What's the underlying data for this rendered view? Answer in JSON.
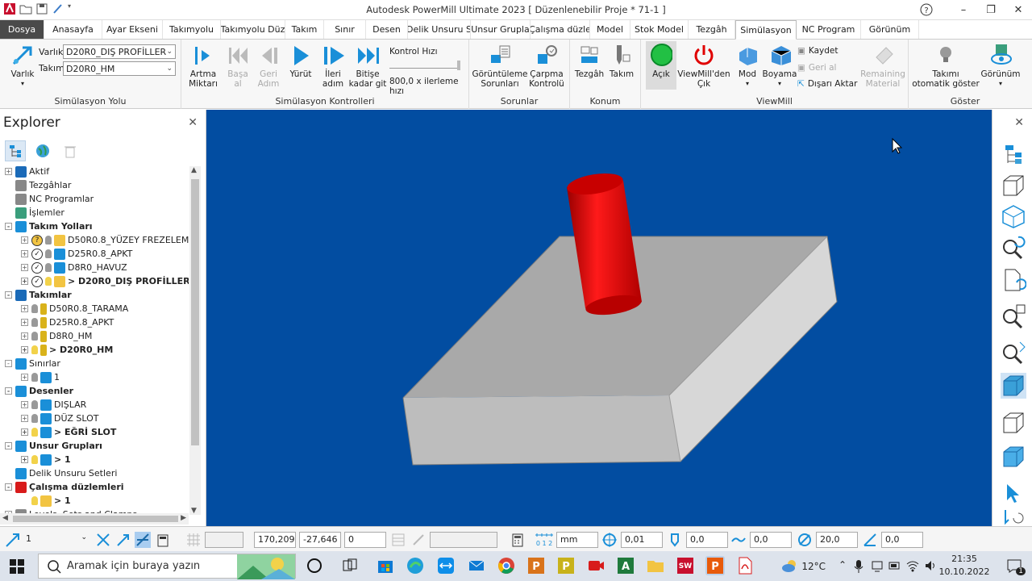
{
  "window": {
    "title": "Autodesk PowerMill Ultimate 2023   [ Düzenlenebilir Proje * 71-1 ]"
  },
  "tabs": [
    "Dosya",
    "Anasayfa",
    "Ayar Ekseni",
    "Takımyolu",
    "Takımyolu Düz",
    "Takım",
    "Sınır",
    "Desen",
    "Delik Unsuru S",
    "Unsur Grupla",
    "Çalışma düzle",
    "Model",
    "Stok Model",
    "Tezgâh",
    "Simülasyon",
    "NC Program",
    "Görünüm"
  ],
  "active_tab": "Simülasyon",
  "ribbon": {
    "sim_path": {
      "varlik_big": "Varlık",
      "varlik_label": "Varlık",
      "varlik_value": "D20R0_DIŞ PROFİLLER",
      "takim_label": "Takım",
      "takim_value": "D20R0_HM",
      "group_label": "Simülasyon Yolu"
    },
    "sim_controls": {
      "artma": "Artma\nMiktarı",
      "basa": "Başa\nal",
      "geri": "Geri\nAdım",
      "yurut": "Yürüt",
      "ileri": "İleri\nadım",
      "bitise": "Bitişe\nkadar git",
      "kontrol_hizi": "Kontrol Hızı",
      "ilerleme": "800,0 x ilerleme hızı",
      "group_label": "Simülasyon Kontrolleri"
    },
    "sorunlar": {
      "goruntuleme": "Görüntüleme\nSorunları",
      "carpma": "Çarpma\nKontrolü",
      "group_label": "Sorunlar"
    },
    "konum": {
      "tezgah": "Tezgâh",
      "takim": "Takım",
      "group_label": "Konum"
    },
    "viewmill": {
      "acik": "Açık",
      "cik": "ViewMill'den\nÇık",
      "mod": "Mod",
      "boyama": "Boyama",
      "kaydet": "Kaydet",
      "geri_al": "Geri al",
      "disari": "Dışarı Aktar",
      "remaining": "Remaining\nMaterial",
      "group_label": "ViewMill"
    },
    "goster": {
      "takimi": "Takımı\notomatik göster",
      "gorunum": "Görünüm",
      "group_label": "Göster"
    }
  },
  "explorer": {
    "title": "Explorer",
    "tree": [
      {
        "label": "Aktif",
        "level": 0,
        "exp": "+",
        "bold": false,
        "icon": "active-icon"
      },
      {
        "label": "Tezgâhlar",
        "level": 0,
        "exp": "",
        "bold": false,
        "icon": "machine-icon"
      },
      {
        "label": "NC Programlar",
        "level": 0,
        "exp": "",
        "bold": false,
        "icon": "nc-program-icon"
      },
      {
        "label": "İşlemler",
        "level": 0,
        "exp": "",
        "bold": false,
        "icon": "operations-icon"
      },
      {
        "label": "Takım Yolları",
        "level": 0,
        "exp": "-",
        "bold": true,
        "icon": "toolpaths-icon"
      },
      {
        "label": "D50R0.8_YÜZEY FREZELEME",
        "level": 1,
        "exp": "+",
        "bold": false,
        "icon": "toolpath-warning-icon"
      },
      {
        "label": "D25R0.8_APKT",
        "level": 1,
        "exp": "+",
        "bold": false,
        "icon": "toolpath-ok-icon"
      },
      {
        "label": "D8R0_HAVUZ",
        "level": 1,
        "exp": "+",
        "bold": false,
        "icon": "toolpath-ok-icon"
      },
      {
        "label": "> D20R0_DIŞ PROFİLLER",
        "level": 1,
        "exp": "+",
        "bold": true,
        "icon": "toolpath-active-icon"
      },
      {
        "label": "Takımlar",
        "level": 0,
        "exp": "-",
        "bold": true,
        "icon": "tools-icon"
      },
      {
        "label": "D50R0.8_TARAMA",
        "level": 1,
        "exp": "+",
        "bold": false,
        "icon": "tool-icon"
      },
      {
        "label": "D25R0.8_APKT",
        "level": 1,
        "exp": "+",
        "bold": false,
        "icon": "tool-icon"
      },
      {
        "label": "D8R0_HM",
        "level": 1,
        "exp": "+",
        "bold": false,
        "icon": "tool-icon"
      },
      {
        "label": "> D20R0_HM",
        "level": 1,
        "exp": "+",
        "bold": true,
        "icon": "tool-active-icon"
      },
      {
        "label": "Sınırlar",
        "level": 0,
        "exp": "-",
        "bold": false,
        "icon": "boundaries-icon"
      },
      {
        "label": "1",
        "level": 1,
        "exp": "+",
        "bold": false,
        "icon": "boundary-icon"
      },
      {
        "label": "Desenler",
        "level": 0,
        "exp": "-",
        "bold": true,
        "icon": "patterns-icon"
      },
      {
        "label": "DIŞLAR",
        "level": 1,
        "exp": "+",
        "bold": false,
        "icon": "pattern-icon"
      },
      {
        "label": "DÜZ SLOT",
        "level": 1,
        "exp": "+",
        "bold": false,
        "icon": "pattern-icon"
      },
      {
        "label": "> EĞRİ SLOT",
        "level": 1,
        "exp": "+",
        "bold": true,
        "icon": "pattern-active-icon"
      },
      {
        "label": "Unsur Grupları",
        "level": 0,
        "exp": "-",
        "bold": true,
        "icon": "feature-groups-icon"
      },
      {
        "label": "> 1",
        "level": 1,
        "exp": "+",
        "bold": true,
        "icon": "feature-group-icon"
      },
      {
        "label": "Delik Unsuru Setleri",
        "level": 0,
        "exp": "",
        "bold": false,
        "icon": "hole-sets-icon"
      },
      {
        "label": "Çalışma düzlemleri",
        "level": 0,
        "exp": "-",
        "bold": true,
        "icon": "workplanes-icon"
      },
      {
        "label": "> 1",
        "level": 1,
        "exp": "",
        "bold": true,
        "icon": "workplane-icon"
      },
      {
        "label": "Levels, Sets and Clamps",
        "level": 0,
        "exp": "+",
        "bold": false,
        "icon": "levels-icon"
      }
    ]
  },
  "statusbar": {
    "workplane": "1",
    "x": "170,209",
    "y": "-27,646",
    "z": "0",
    "unit": "mm",
    "tolerance": "0,01",
    "stock": "0,0",
    "thickness": "0,0",
    "diameter": "20,0",
    "angle": "0,0"
  },
  "taskbar": {
    "search_placeholder": "Aramak için buraya yazın",
    "temperature": "12°C",
    "time": "21:35",
    "date": "10.10.2022",
    "notifications": "1"
  },
  "colors": {
    "viewport": "#024da1",
    "stock": "#a9a9a9",
    "tool": "#e00000"
  }
}
